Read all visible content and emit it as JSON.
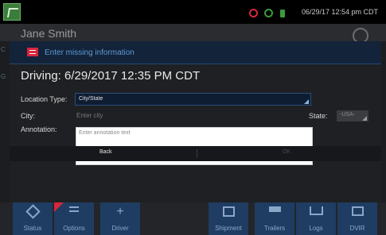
{
  "status_bar": {
    "time": "06/29/17 12:54 pm CDT",
    "icons": [
      "app-icon",
      "alert-icon",
      "signal-icon",
      "battery-icon"
    ],
    "colors": {
      "alert": "#d7263d",
      "ok": "#3a9a3a"
    }
  },
  "background": {
    "driver_name": "Jane Smith"
  },
  "dialog": {
    "title": "Enter missing information",
    "driving_text": "Driving: 6/29/2017 12:35 PM CDT",
    "location_type": {
      "label": "Location Type:",
      "value": "City/State"
    },
    "city": {
      "label": "City:",
      "placeholder": "Enter city"
    },
    "state": {
      "label": "State:",
      "value": "-USA-"
    },
    "annotation": {
      "label": "Annotation:",
      "placeholder": "Enter annotation text"
    },
    "buttons": {
      "back": "Back",
      "ok": "OK"
    }
  },
  "nav": {
    "items": [
      {
        "label": "Status",
        "icon": "diamond-icon"
      },
      {
        "label": "Options",
        "icon": "list-icon"
      },
      {
        "label": "Driver",
        "icon": "plus-icon"
      },
      {
        "label": "Shipment",
        "icon": "calendar-icon"
      },
      {
        "label": "Trailers",
        "icon": "trailer-icon"
      },
      {
        "label": "Logs",
        "icon": "logs-icon"
      },
      {
        "label": "DVIR",
        "icon": "dvir-icon"
      }
    ]
  }
}
